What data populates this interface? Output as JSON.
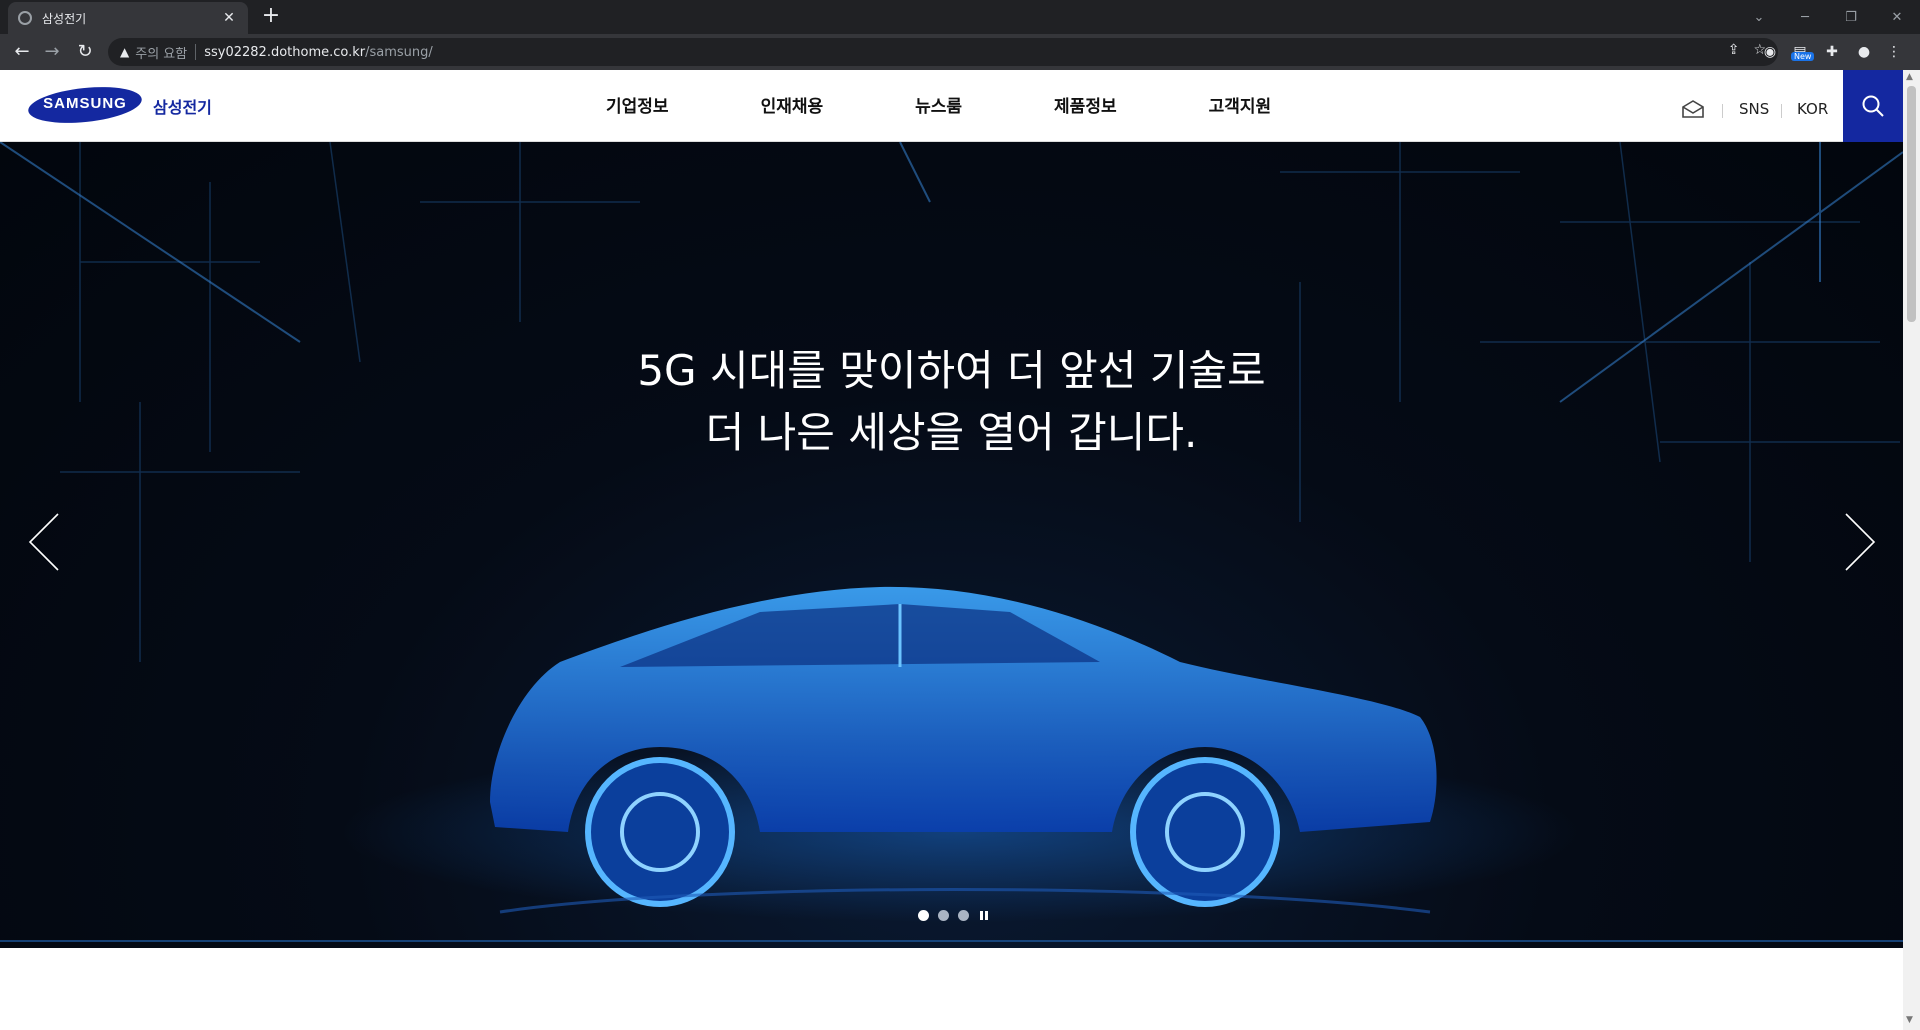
{
  "browser": {
    "tab_title": "삼성전기",
    "security_label": "주의 요함",
    "url_host": "ssy02282.dothome.co.kr",
    "url_path": "/samsung/",
    "extension_badge": "New",
    "icons": [
      "back-icon",
      "forward-icon",
      "reload-icon",
      "warning-icon",
      "share-icon",
      "star-icon",
      "extension-icon",
      "puzzle-icon",
      "profile-icon",
      "menu-icon"
    ]
  },
  "header": {
    "logo_text": "SAMSUNG",
    "brand_ko": "삼성전기",
    "nav": [
      "기업정보",
      "인재채용",
      "뉴스룸",
      "제품정보",
      "고객지원"
    ],
    "util_sns": "SNS",
    "util_lang": "KOR",
    "accent_color": "#1428a0"
  },
  "hero": {
    "headline_line1": "5G 시대를 맞이하여 더 앞선 기술로",
    "headline_line2": "더 나은 세상을 열어 갑니다.",
    "slide_count": 3,
    "active_slide": 1
  }
}
